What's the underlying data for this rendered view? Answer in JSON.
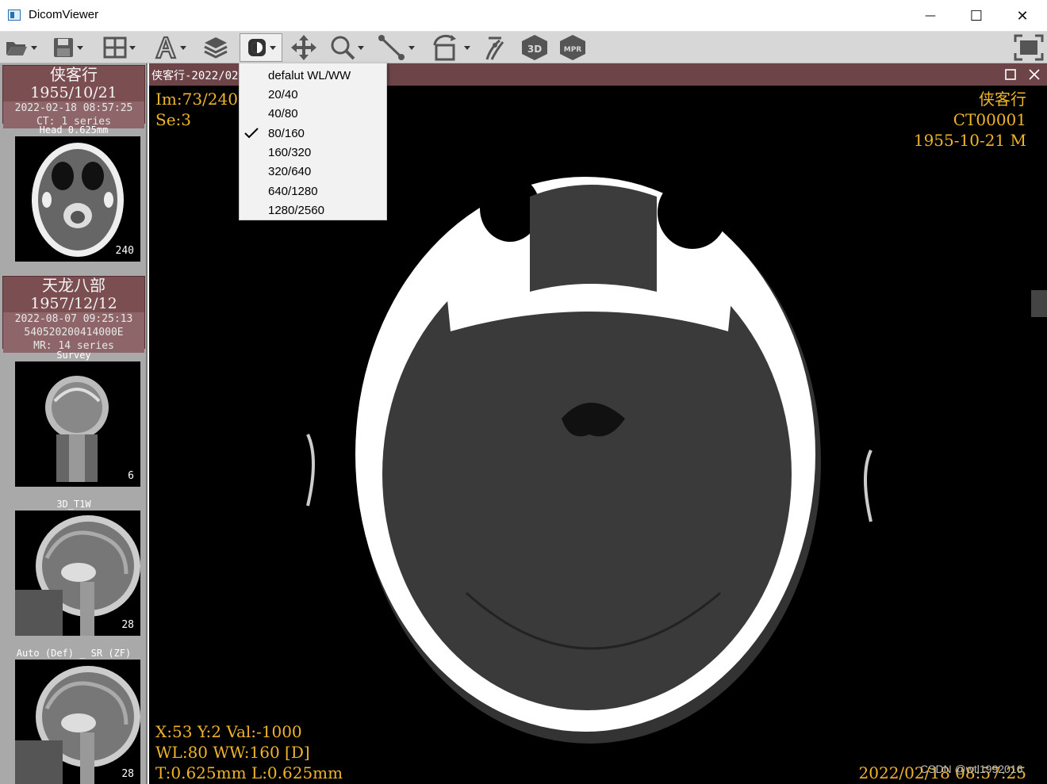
{
  "window": {
    "title": "DicomViewer",
    "minimize": "—",
    "maximize": "☐",
    "close": "✕"
  },
  "toolbar": {
    "items": [
      "open-icon",
      "save-icon",
      "layout-icon",
      "annotation-icon",
      "layers-icon",
      "window-level-icon",
      "pan-icon",
      "zoom-icon",
      "measure-icon",
      "rotate-icon",
      "flip-icon",
      "3d-icon",
      "mpr-icon",
      "fullscreen-icon"
    ],
    "label_3d": "3D",
    "label_mpr": "MPR"
  },
  "sidebar": {
    "patients": [
      {
        "name": "侠客行",
        "birth": "1955/10/21",
        "study_time": "2022-02-18 08:57:25",
        "modality_line": "CT: 1 series",
        "id_line": ""
      },
      {
        "name": "天龙八部",
        "birth": "1957/12/12",
        "study_time": "2022-08-07 09:25:13",
        "id_line": "540520200414000E",
        "modality_line": "MR: 14 series"
      }
    ],
    "series": [
      {
        "label": "Head 0.625mm",
        "count": "240"
      },
      {
        "label": "Survey",
        "count": "6"
      },
      {
        "label": "3D_T1W",
        "count": "28"
      },
      {
        "label": "Auto (Def) _ SR (ZF)",
        "count": "28"
      }
    ]
  },
  "viewer": {
    "tab_title": "侠客行-2022/02/",
    "top_left": {
      "image": "Im:73/240",
      "series": "Se:3"
    },
    "top_right": {
      "name": "侠客行",
      "id": "CT00001",
      "birth_sex": "1955-10-21 M"
    },
    "bottom_left": {
      "cursor": "X:53 Y:2 Val:-1000",
      "wlww": "WL:80 WW:160 [D]",
      "thickness": "T:0.625mm L:0.625mm"
    },
    "bottom_right": {
      "datetime": "2022/02/18 08:57:25"
    }
  },
  "wl_menu": {
    "items": [
      "defalut WL/WW",
      "20/40",
      "40/80",
      "80/160",
      "160/320",
      "320/640",
      "640/1280",
      "1280/2560"
    ],
    "checked_index": 3
  },
  "watermark": "CSDN @wtl1992016",
  "colors": {
    "accent": "#f0b429",
    "patient_header": "#7b4e52",
    "toolbar": "#d7d7d7"
  }
}
